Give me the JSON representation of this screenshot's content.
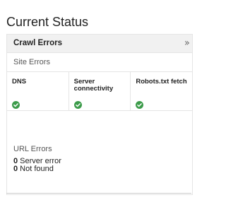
{
  "page_title": "Current Status",
  "crawl_errors": {
    "title": "Crawl Errors",
    "expand_icon": "double-chevron-right-icon",
    "site_errors": {
      "label": "Site Errors",
      "items": [
        {
          "label": "DNS",
          "status": "ok",
          "icon": "check-circle-icon"
        },
        {
          "label": "Server connectivity",
          "status": "ok",
          "icon": "check-circle-icon"
        },
        {
          "label": "Robots.txt fetch",
          "status": "ok",
          "icon": "check-circle-icon"
        }
      ]
    },
    "url_errors": {
      "label": "URL Errors",
      "items": [
        {
          "count": "0",
          "text": " Server error"
        },
        {
          "count": "0",
          "text": " Not found"
        }
      ]
    }
  },
  "colors": {
    "status_ok": "#3c9b4a",
    "header_bg": "#f1f1f1",
    "border": "#e5e5e5"
  }
}
